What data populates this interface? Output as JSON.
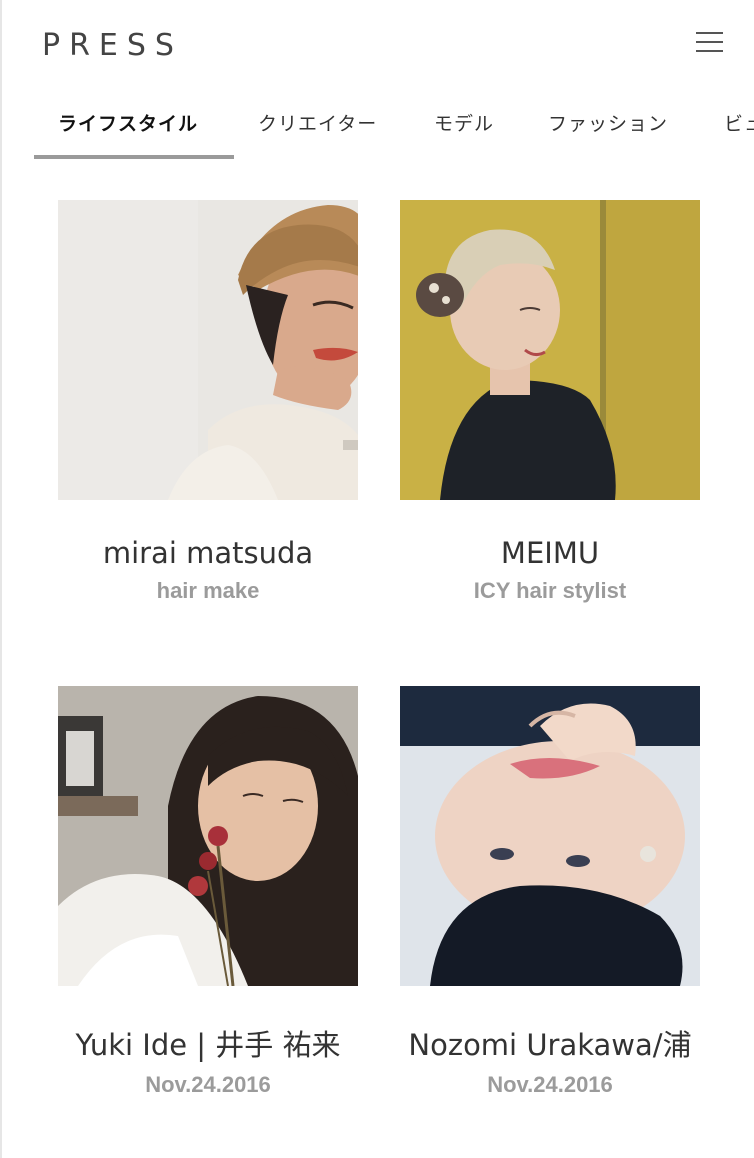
{
  "header": {
    "logo": "PRESS"
  },
  "tabs": [
    {
      "label": "ライフスタイル",
      "active": true
    },
    {
      "label": "クリエイター"
    },
    {
      "label": "モデル"
    },
    {
      "label": "ファッション"
    },
    {
      "label": "ビュ"
    }
  ],
  "cards": [
    {
      "name": "mirai matsuda",
      "sub": "hair make"
    },
    {
      "name": "MEIMU",
      "sub": "ICY hair stylist"
    },
    {
      "name": "Yuki Ide | 井手 祐来",
      "sub": "Nov.24.2016"
    },
    {
      "name": "Nozomi Urakawa/浦",
      "sub": "Nov.24.2016"
    }
  ]
}
